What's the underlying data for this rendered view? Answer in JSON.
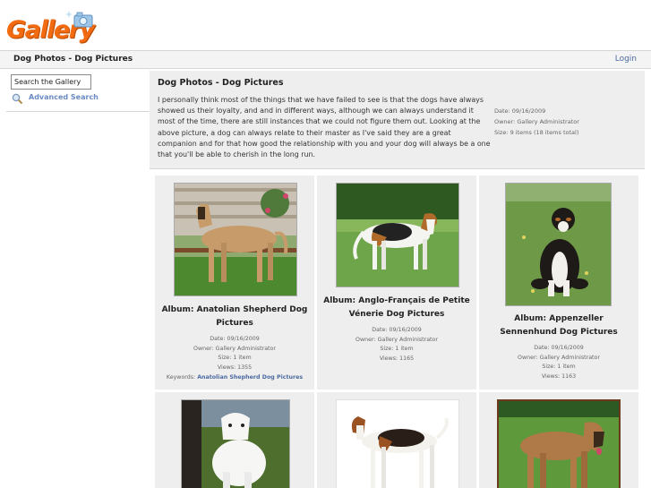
{
  "header": {
    "logo_text": "Gallery",
    "breadcrumb": "Dog Photos - Dog Pictures",
    "login_label": "Login"
  },
  "sidebar": {
    "search_value": "Search the Gallery",
    "advanced_search_label": "Advanced Search"
  },
  "album": {
    "title": "Dog Photos - Dog Pictures",
    "description": "I personally think most of the things that we have failed to see is that the dogs have always showed us their loyalty, and and in different ways, although we can always understand it most of the time, there are still instances that we could not figure them out. Looking at the above picture, a dog can always relate to their master as I've said they are a great companion and for that how good the relationship with you and your dog will always be a one that you'll be able to cherish in the long run.",
    "date": "Date: 09/16/2009",
    "owner": "Owner: Gallery Administrator",
    "size": "Size: 9 items (18 items total)"
  },
  "items": [
    {
      "title": "Album: Anatolian Shepherd Dog Pictures",
      "date": "Date: 09/16/2009",
      "owner": "Owner: Gallery Administrator",
      "size": "Size: 1 item",
      "views": "Views: 1355",
      "keywords_label": "Keywords:",
      "keywords_value": "Anatolian Shepherd Dog Pictures"
    },
    {
      "title": "Album: Anglo-Français de Petite Vénerie Dog Pictures",
      "date": "Date: 09/16/2009",
      "owner": "Owner: Gallery Administrator",
      "size": "Size: 1 item",
      "views": "Views: 1165"
    },
    {
      "title": "Album: Appenzeller Sennenhund Dog Pictures",
      "date": "Date: 09/16/2009",
      "owner": "Owner: Gallery Administrator",
      "size": "Size: 1 item",
      "views": "Views: 1163"
    }
  ],
  "colors": {
    "logo_orange": "#f26b10",
    "link_blue": "#4b6aa0",
    "panel_gray": "#eeeeee"
  }
}
